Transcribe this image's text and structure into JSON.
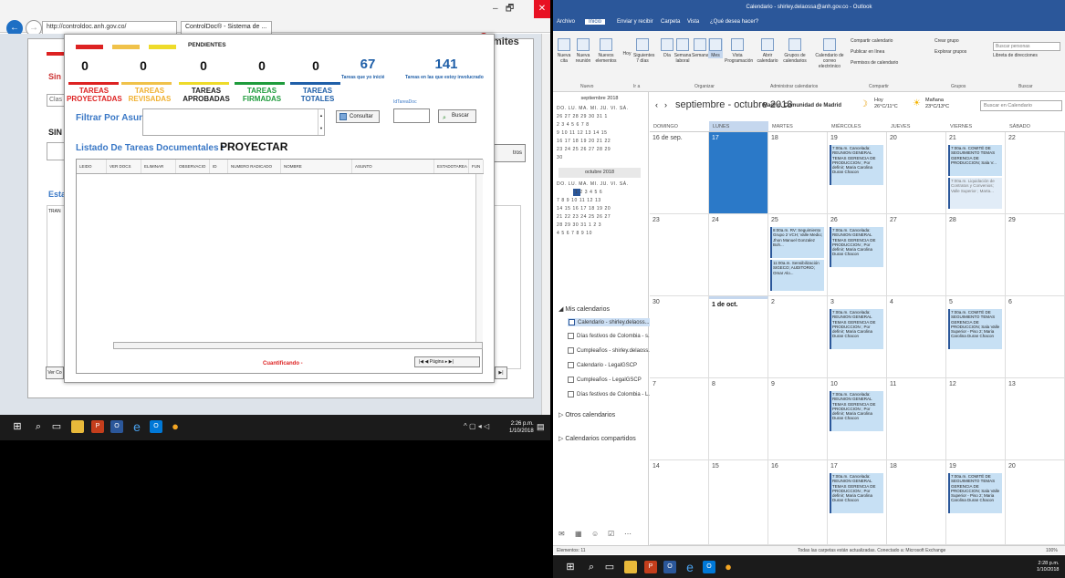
{
  "ie": {
    "address": "http://controldoc.anh.gov.co/",
    "tab_title": "ControlDoc® - Sistema de ...",
    "bg_limites": "mites",
    "bg_sin": "Sin i",
    "bg_cla": "Clas",
    "bg_sin2": "SIN",
    "bg_est": "Esta",
    "bg_tran": "TRAN",
    "bg_tros": "tros"
  },
  "modal": {
    "pendientes": "PENDIENTES",
    "counts": [
      "0",
      "0",
      "0",
      "0",
      "0"
    ],
    "categories": [
      "TAREAS PROYECTADAS",
      "TAREAS REVISADAS",
      "TAREAS APROBADAS",
      "TAREAS FIRMADAS",
      "TAREAS TOTALES"
    ],
    "inicie_num": "67",
    "inicie_lbl": "Tareas que yo inicié",
    "involucrado_num": "141",
    "involucrado_lbl": "Tareas en las que estoy involucrado",
    "filtro_label": "Filtrar Por Asunto :",
    "consultar": "Consultar",
    "idtarea_label": "IdTareaDoc",
    "buscar": "Buscar",
    "listado_label": "Listado De Tareas Documentales :",
    "proyectar": "PROYECTAR",
    "columns": [
      "LEIDO",
      "VER DOCS",
      "ELIMINAR",
      "OBSERVACIO",
      "ID",
      "NUMERO RADICADO",
      "NOMBRE",
      "ASUNTO",
      "ESTADOTAREA",
      "FUN"
    ],
    "cuantificando": "Cuantificando -",
    "pager": "|◀ ◀ Página ▸ ▶|",
    "ver_btn": "Ver Co"
  },
  "left_taskbar": {
    "time": "2:26 p.m.",
    "date": "1/10/2018"
  },
  "outlook": {
    "title": "Calendario - shirley.delaossa@anh.gov.co - Outlook",
    "tabs": [
      "Archivo",
      "Inicio",
      "Enviar y recibir",
      "Carpeta",
      "Vista",
      "¿Qué desea hacer?"
    ],
    "ribbon": {
      "nueva_cita": "Nueva cita",
      "nueva_reunion": "Nueva reunión",
      "nuevos_elementos": "Nuevos elementos",
      "hoy": "Hoy",
      "siguientes": "Siguientes 7 días",
      "dia": "Día",
      "semana_laboral": "Semana laboral",
      "semana": "Semana",
      "mes": "Mes",
      "vista_programacion": "Vista Programación",
      "abrir": "Abrir calendario",
      "grupos_cal": "Grupos de calendarios",
      "calendario_correo": "Calendario de correo electrónico",
      "compartir": "Compartir calendario",
      "publicar": "Publicar en línea",
      "permisos": "Permisos de calendario",
      "crear_grupo": "Crear grupo",
      "explorar": "Explorar grupos",
      "buscar_personas": "Buscar personas",
      "libreta": "Libreta de direcciones",
      "g_nuevo": "Nuevo",
      "g_ir": "Ir a",
      "g_organizar": "Organizar",
      "g_admin": "Administrar calendarios",
      "g_compartir": "Compartir",
      "g_grupos": "Grupos",
      "g_buscar": "Buscar"
    },
    "mini1_title": "septiembre 2018",
    "mini_days": "DO. LU. MA. MI. JU. VI. SÁ.",
    "mini1_rows": [
      "26 27 28 29 30 31 1",
      "2 3 4 5 6 7 8",
      "9 10 11 12 13 14 15",
      "16 17 18 19 20 21 22",
      "23 24 25 26 27 28 29",
      "30"
    ],
    "mini2_title": "octubre 2018",
    "mini2_rows": [
      "1 2 3 4 5 6",
      "7 8 9 10 11 12 13",
      "14 15 16 17 18 19 20",
      "21 22 23 24 25 26 27",
      "28 29 30 31 1 2 3",
      "4 5 6 7 8 9 10"
    ],
    "mis_calendarios": "Mis calendarios",
    "calendars": [
      "Calendario - shirley.delaoss...",
      "Días festivos de Colombia - s...",
      "Cumpleaños - shirley.delaoss...",
      "Calendario - LegalGSCP",
      "Cumpleaños - LegalGSCP",
      "Días festivos de Colombia - L..."
    ],
    "otros": "Otros calendarios",
    "compartidos": "Calendarios compartidos",
    "month_title": "septiembre - octubre 2018",
    "city": "Madrid, Comunidad de Madrid",
    "hoy_lbl": "Hoy",
    "hoy_temp": "26°C/11°C",
    "man_lbl": "Mañana",
    "man_temp": "23°C/13°C",
    "search": "Buscar en Calendario",
    "weekdays": [
      "DOMINGO",
      "LUNES",
      "MARTES",
      "MIÉRCOLES",
      "JUEVES",
      "VIERNES",
      "SÁBADO"
    ],
    "weeks": [
      [
        "16 de sep.",
        "17",
        "18",
        "19",
        "20",
        "21",
        "22"
      ],
      [
        "23",
        "24",
        "25",
        "26",
        "27",
        "28",
        "29"
      ],
      [
        "30",
        "1 de oct.",
        "2",
        "3",
        "4",
        "5",
        "6"
      ],
      [
        "7",
        "8",
        "9",
        "10",
        "11",
        "12",
        "13"
      ],
      [
        "14",
        "15",
        "16",
        "17",
        "18",
        "19",
        "20"
      ]
    ],
    "events": {
      "e19": "7:00a.m. Cancelada: REUNION GENERAL TEMAS GERENCIA DE PRODUCCION ; Por definir; Maria Carolina Duran Chacon",
      "e21a": "7:00a.m. COMITÉ DE SEGUIMIENTO TEMAS GERENCIA DE PRODUCCION; Sala V...",
      "e21b": "7:00a.m. Liquidación de Contratos y Convenios; Valle Superior ; Marta...",
      "e25a": "8:00a.m. RV: Seguimiento Grupo 2 VCH; Valle Medio; Jhon Manuel Gonzalez Boh...",
      "e25b": "11:00a.m. Sensibilización SIGECO; AUDITORIO; Omar Alo...",
      "e26": "7:00a.m. Cancelada: REUNION GENERAL TEMAS GERENCIA DE PRODUCCION ; Por definir; Maria Carolina Duran Chacon",
      "e3": "7:00a.m. Cancelada: REUNION GENERAL TEMAS GERENCIA DE PRODUCCION ; Por definir; Maria Carolina Duran Chacon",
      "e5": "7:00a.m. COMITÉ DE SEGUIMIENTO TEMAS GERENCIA DE PRODUCCION; Sala Valle Superior - Piso 2; Maria Carolina Duran Chacon",
      "e10": "7:00a.m. Cancelada: REUNION GENERAL TEMAS GERENCIA DE PRODUCCION ; Por definir; Maria Carolina Duran Chacon",
      "e17": "7:00a.m. Cancelada: REUNION GENERAL TEMAS GERENCIA DE PRODUCCION ; Por definir; Maria Carolina Duran Chacon",
      "e19b": "7:00a.m. COMITÉ DE SEGUIMIENTO TEMAS GERENCIA DE PRODUCCION; Sala Valle Superior - Piso 2; Maria Carolina Duran Chacon"
    },
    "status_left": "Elementos: 11",
    "status_right": "Todas las carpetas están actualizadas.    Conectado a: Microsoft Exchange",
    "status_zoom": "100%",
    "time": "2:28 p.m.",
    "date": "1/10/2018"
  }
}
